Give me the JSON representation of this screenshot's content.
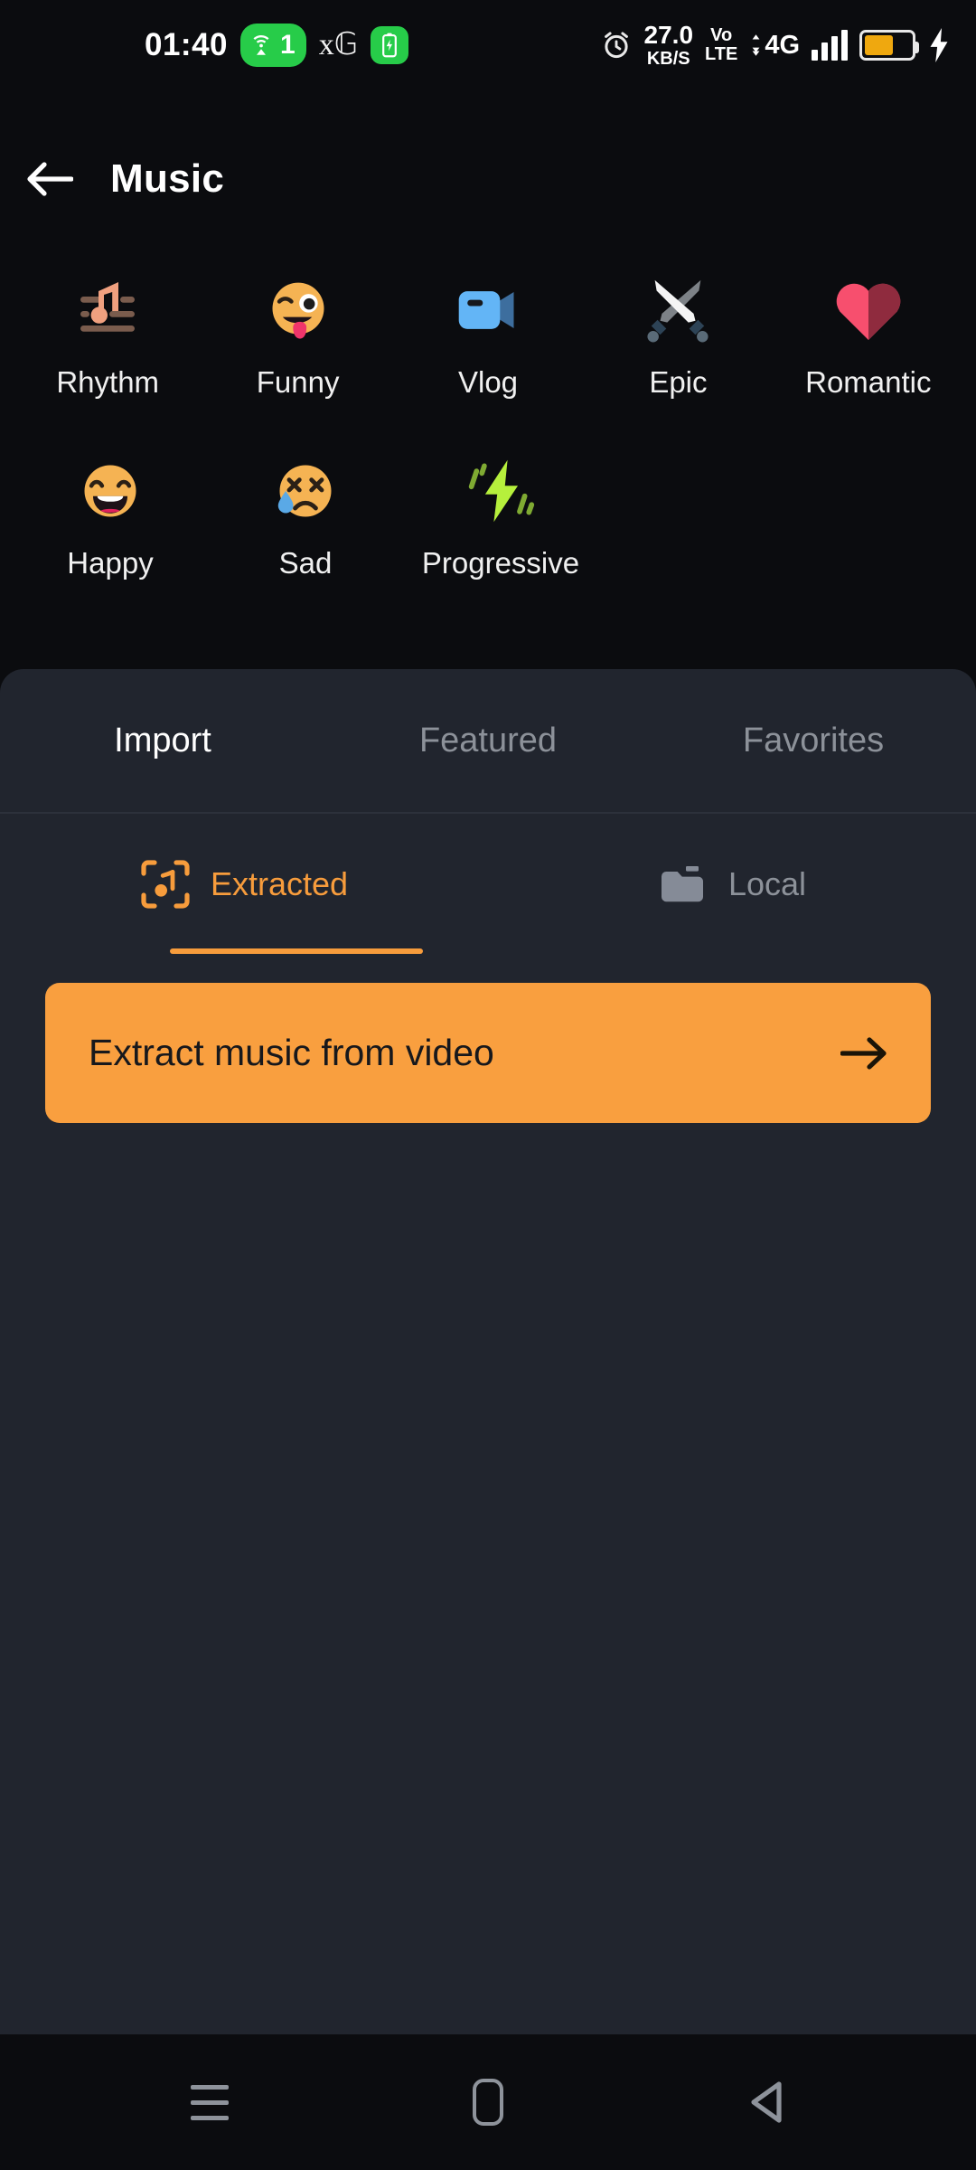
{
  "statusbar": {
    "time": "01:40",
    "hotspot_count": "1",
    "hotspot_icon": "wifi-hotspot-icon",
    "google_icon": "google-g-icon",
    "battery_saver_icon": "battery-saver-icon",
    "alarm_icon": "alarm-clock-icon",
    "netspeed_value": "27.0",
    "netspeed_unit": "KB/S",
    "volte_top": "Vo",
    "volte_bottom": "LTE",
    "network_type": "4G",
    "signal_icon": "signal-bars-icon",
    "battery_icon": "battery-icon",
    "charging_icon": "charging-bolt-icon",
    "battery_level_pct": 62,
    "battery_color": "#efa80f"
  },
  "appbar": {
    "back_icon": "back-arrow-icon",
    "title": "Music"
  },
  "categories": [
    {
      "label": "Rhythm",
      "icon": "rhythm-music-note-icon"
    },
    {
      "label": "Funny",
      "icon": "funny-winking-tongue-emoji-icon"
    },
    {
      "label": "Vlog",
      "icon": "vlog-video-camera-icon"
    },
    {
      "label": "Epic",
      "icon": "epic-crossed-swords-icon"
    },
    {
      "label": "Romantic",
      "icon": "romantic-heart-icon"
    },
    {
      "label": "Happy",
      "icon": "happy-grinning-emoji-icon"
    },
    {
      "label": "Sad",
      "icon": "sad-crying-emoji-icon"
    },
    {
      "label": "Progressive",
      "icon": "progressive-lightning-bolt-icon"
    }
  ],
  "panel": {
    "tabs": [
      {
        "label": "Import",
        "active": true
      },
      {
        "label": "Featured",
        "active": false
      },
      {
        "label": "Favorites",
        "active": false
      }
    ],
    "subtabs": [
      {
        "label": "Extracted",
        "icon": "extracted-scan-music-icon",
        "active": true
      },
      {
        "label": "Local",
        "icon": "folder-icon",
        "active": false
      }
    ],
    "extract_button": {
      "label": "Extract music from video",
      "arrow_icon": "arrow-right-icon",
      "color": "#f99f3f"
    }
  },
  "navbar": {
    "recents_icon": "recents-menu-icon",
    "home_icon": "home-icon",
    "back_icon": "nav-back-triangle-icon"
  },
  "theme": {
    "background": "#0b0c0f",
    "panel_background": "#21252e",
    "accent": "#f79c3c",
    "muted_text": "#8c9199"
  }
}
